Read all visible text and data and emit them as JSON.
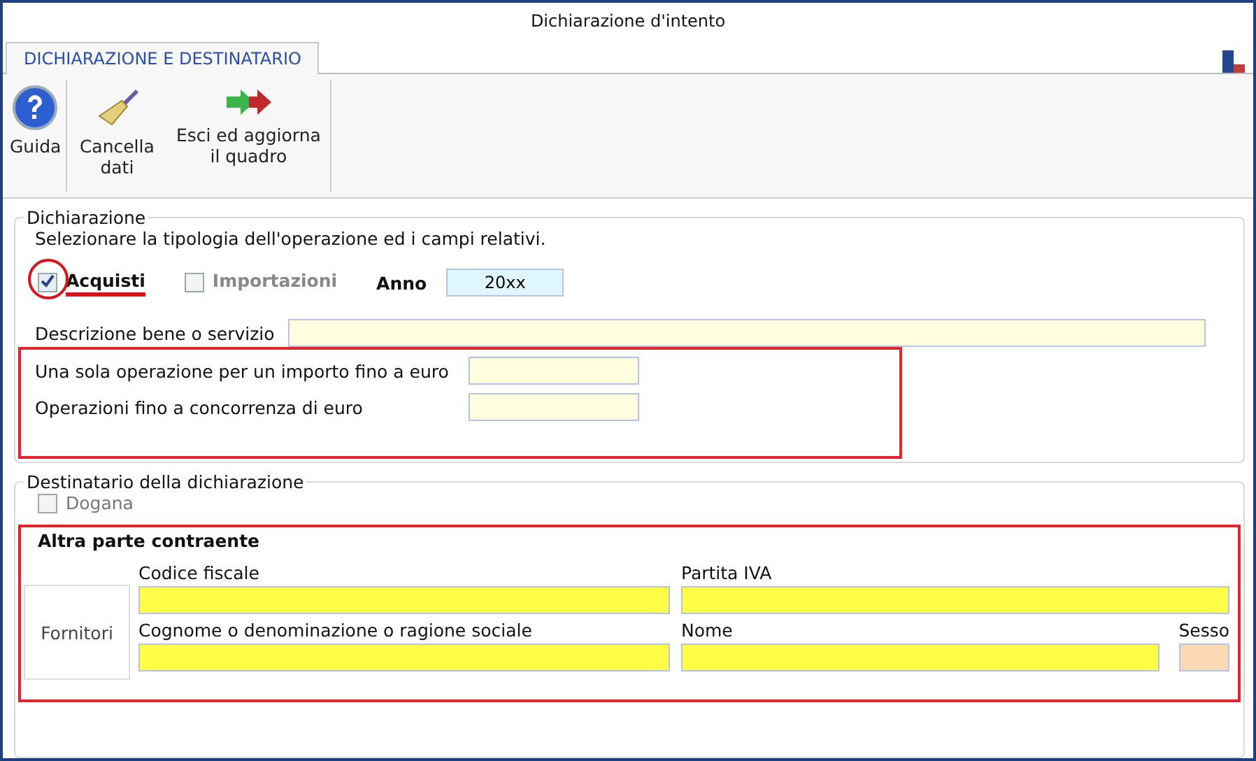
{
  "window": {
    "title": "Dichiarazione d'intento"
  },
  "tabs": [
    {
      "label": "DICHIARAZIONE E DESTINATARIO",
      "selected": true
    }
  ],
  "toolbar": [
    {
      "kind": "help",
      "label": "Guida"
    },
    {
      "kind": "clear",
      "label": "Cancella dati"
    },
    {
      "kind": "exit",
      "label": "Esci ed aggiorna il quadro"
    }
  ],
  "dichiarazione": {
    "legend": "Dichiarazione",
    "instruction": "Selezionare la tipologia dell'operazione ed i campi relativi.",
    "options": [
      {
        "label": "Acquisti",
        "checked": true,
        "disabled": false,
        "highlighted": true
      },
      {
        "label": "Importazioni",
        "checked": false,
        "disabled": true,
        "highlighted": false
      }
    ],
    "year": {
      "label": "Anno",
      "value": "20xx"
    },
    "description": {
      "label": "Descrizione bene o servizio"
    },
    "amounts": {
      "highlighted": true,
      "fields": [
        {
          "label": "Una sola operazione per un importo fino a euro"
        },
        {
          "label": "Operazioni fino a concorrenza di euro"
        }
      ]
    }
  },
  "destinatario": {
    "legend": "Destinatario della dichiarazione",
    "customs": {
      "label": "Dogana",
      "checked": false,
      "disabled": true
    },
    "counterparty": {
      "highlighted": true,
      "title": "Altra parte contraente",
      "category": "Fornitori",
      "fields": [
        {
          "label": "Codice fiscale",
          "kind": "wide"
        },
        {
          "label": "Partita IVA",
          "kind": "wide"
        },
        {
          "label": "Cognome o denominazione o ragione sociale",
          "kind": "wide"
        },
        {
          "label": "Nome",
          "kind": "wide"
        },
        {
          "label": "Sesso",
          "kind": "small"
        }
      ]
    }
  }
}
